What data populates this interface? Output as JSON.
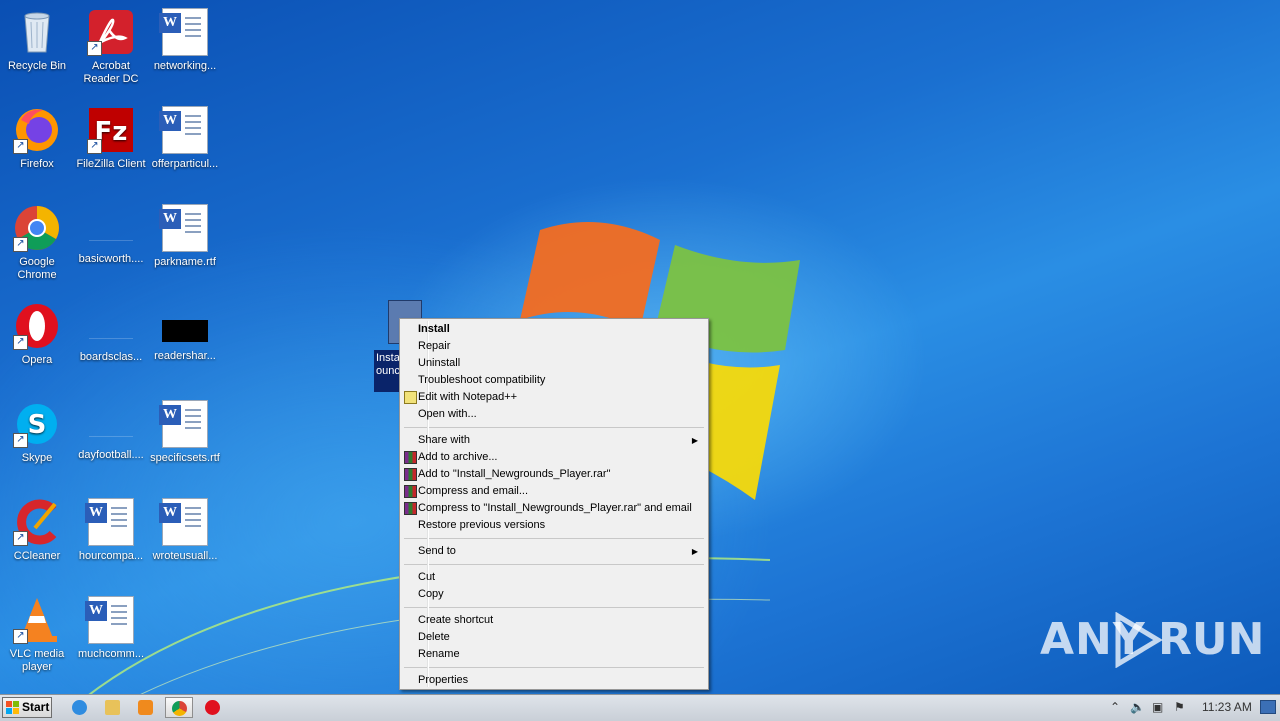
{
  "desktop": {
    "icons": [
      {
        "label": "Recycle Bin"
      },
      {
        "label": "Acrobat Reader DC"
      },
      {
        "label": "networking..."
      },
      {
        "label": "Firefox"
      },
      {
        "label": "FileZilla Client"
      },
      {
        "label": "offerparticul..."
      },
      {
        "label": "Google Chrome"
      },
      {
        "label": "basicworth...."
      },
      {
        "label": "parkname.rtf"
      },
      {
        "label": "Opera"
      },
      {
        "label": "boardsclas..."
      },
      {
        "label": "readershar..."
      },
      {
        "label": "Skype"
      },
      {
        "label": "dayfootball...."
      },
      {
        "label": "specificsets.rtf"
      },
      {
        "label": "CCleaner"
      },
      {
        "label": "hourcompa..."
      },
      {
        "label": "wroteusuall..."
      },
      {
        "label": "VLC media player"
      },
      {
        "label": "muchcomm..."
      }
    ],
    "selected_file_label": "Insta ounc"
  },
  "context_menu": {
    "items": [
      {
        "label": "Install"
      },
      {
        "label": "Repair"
      },
      {
        "label": "Uninstall"
      },
      {
        "label": "Troubleshoot compatibility"
      },
      {
        "label": "Edit with Notepad++"
      },
      {
        "label": "Open with..."
      },
      {
        "label": "Share with"
      },
      {
        "label": "Add to archive..."
      },
      {
        "label": "Add to \"Install_Newgrounds_Player.rar\""
      },
      {
        "label": "Compress and email..."
      },
      {
        "label": "Compress to \"Install_Newgrounds_Player.rar\" and email"
      },
      {
        "label": "Restore previous versions"
      },
      {
        "label": "Send to"
      },
      {
        "label": "Cut"
      },
      {
        "label": "Copy"
      },
      {
        "label": "Create shortcut"
      },
      {
        "label": "Delete"
      },
      {
        "label": "Rename"
      },
      {
        "label": "Properties"
      }
    ]
  },
  "watermark": {
    "left": "ANY",
    "right": "RUN"
  },
  "taskbar": {
    "start_label": "Start",
    "clock": "11:23 AM"
  }
}
